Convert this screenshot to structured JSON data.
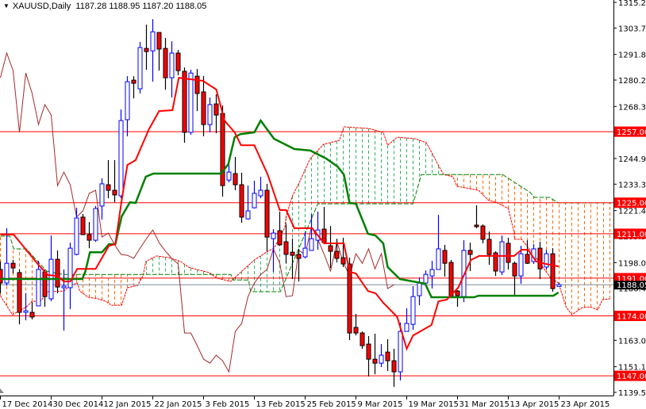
{
  "title": {
    "symbol": "XAUUSD,Daily",
    "ohlc": "1187.28 1188.95 1187.20 1188.05"
  },
  "chart_data": {
    "type": "candlestick",
    "symbol": "XAUUSD",
    "timeframe": "Daily",
    "ylim": [
      1139.55,
      1315.25
    ],
    "grid": false,
    "y_ticks": [
      "1315.25",
      "1303.70",
      "1291.80",
      "1280.25",
      "1268.35",
      "1244.90",
      "1233.35",
      "1221.45",
      "1209.90",
      "1198.00",
      "1186.45",
      "1163.00",
      "1151.10",
      "1139.55"
    ],
    "x_ticks": [
      {
        "bar": 0,
        "label": "17 Dec 2014"
      },
      {
        "bar": 8,
        "label": "30 Dec 2014"
      },
      {
        "bar": 16,
        "label": "12 Jan 2015"
      },
      {
        "bar": 24,
        "label": "22 Jan 2015"
      },
      {
        "bar": 32,
        "label": "3 Feb 2015"
      },
      {
        "bar": 40,
        "label": "13 Feb 2015"
      },
      {
        "bar": 48,
        "label": "25 Feb 2015"
      },
      {
        "bar": 56,
        "label": "9 Mar 2015"
      },
      {
        "bar": 64,
        "label": "19 Mar 2015"
      },
      {
        "bar": 72,
        "label": "31 Mar 2015"
      },
      {
        "bar": 80,
        "label": "13 Apr 2015"
      },
      {
        "bar": 88,
        "label": "23 Apr 2015"
      }
    ],
    "levels": [
      {
        "price": 1257.0,
        "label": "1257.00"
      },
      {
        "price": 1225.0,
        "label": "1225.00"
      },
      {
        "price": 1211.0,
        "label": "1211.00"
      },
      {
        "price": 1191.0,
        "label": "1191.00"
      },
      {
        "price": 1174.0,
        "label": "1174.00"
      },
      {
        "price": 1147.0,
        "label": "1147.00"
      }
    ],
    "current_price": {
      "price": 1188.05,
      "label": "1188.05"
    },
    "candles_format": "open,high,low,close",
    "candles": [
      [
        1194.9,
        1198.5,
        1184.2,
        1188.8
      ],
      [
        1188.8,
        1213.5,
        1187.7,
        1197.7
      ],
      [
        1197.7,
        1199.2,
        1193.1,
        1195.6
      ],
      [
        1193.5,
        1194.9,
        1170.2,
        1175.6
      ],
      [
        1175.6,
        1184.2,
        1172.0,
        1176.3
      ],
      [
        1175.6,
        1180.2,
        1172.4,
        1173.5
      ],
      [
        1178.5,
        1198.8,
        1178.5,
        1194.9
      ],
      [
        1193.8,
        1194.9,
        1178.1,
        1182.7
      ],
      [
        1181.7,
        1210.2,
        1180.6,
        1199.5
      ],
      [
        1199.5,
        1203.5,
        1184.2,
        1187.0
      ],
      [
        1186.7,
        1194.9,
        1167.4,
        1187.4
      ],
      [
        1186.7,
        1207.0,
        1177.0,
        1204.5
      ],
      [
        1201.7,
        1222.7,
        1201.3,
        1218.1
      ],
      [
        1218.5,
        1219.9,
        1210.6,
        1210.6
      ],
      [
        1210.6,
        1216.3,
        1204.5,
        1208.1
      ],
      [
        1208.1,
        1223.5,
        1207.4,
        1222.4
      ],
      [
        1223.5,
        1236.0,
        1217.4,
        1233.5
      ],
      [
        1233.1,
        1244.2,
        1227.0,
        1230.6
      ],
      [
        1230.6,
        1244.2,
        1225.2,
        1228.5
      ],
      [
        1228.1,
        1267.0,
        1227.0,
        1262.0
      ],
      [
        1262.4,
        1282.0,
        1254.9,
        1279.5
      ],
      [
        1280.2,
        1282.0,
        1272.0,
        1278.8
      ],
      [
        1276.3,
        1297.4,
        1274.2,
        1294.9
      ],
      [
        1294.5,
        1305.2,
        1284.9,
        1293.1
      ],
      [
        1293.4,
        1307.7,
        1279.5,
        1302.0
      ],
      [
        1301.7,
        1301.7,
        1284.5,
        1294.2
      ],
      [
        1294.5,
        1299.2,
        1275.9,
        1281.3
      ],
      [
        1281.3,
        1297.7,
        1272.4,
        1292.4
      ],
      [
        1292.4,
        1293.8,
        1282.4,
        1284.5
      ],
      [
        1284.2,
        1285.9,
        1252.0,
        1256.7
      ],
      [
        1256.7,
        1284.9,
        1255.6,
        1283.4
      ],
      [
        1282.0,
        1285.2,
        1266.3,
        1274.2
      ],
      [
        1274.9,
        1282.0,
        1254.9,
        1260.2
      ],
      [
        1260.2,
        1272.4,
        1256.7,
        1269.2
      ],
      [
        1269.5,
        1273.8,
        1256.3,
        1264.5
      ],
      [
        1265.2,
        1268.8,
        1227.7,
        1232.7
      ],
      [
        1235.2,
        1242.0,
        1234.2,
        1238.8
      ],
      [
        1238.1,
        1245.6,
        1230.6,
        1233.1
      ],
      [
        1233.1,
        1238.5,
        1216.0,
        1218.5
      ],
      [
        1217.7,
        1232.7,
        1217.4,
        1221.3
      ],
      [
        1222.7,
        1234.9,
        1222.4,
        1229.2
      ],
      [
        1228.1,
        1236.7,
        1227.0,
        1230.6
      ],
      [
        1230.6,
        1233.5,
        1203.1,
        1209.5
      ],
      [
        1208.8,
        1213.1,
        1193.8,
        1211.3
      ],
      [
        1212.4,
        1221.0,
        1205.6,
        1206.0
      ],
      [
        1207.4,
        1215.2,
        1197.7,
        1201.7
      ],
      [
        1202.7,
        1208.8,
        1190.6,
        1201.3
      ],
      [
        1201.7,
        1204.2,
        1189.5,
        1199.9
      ],
      [
        1200.6,
        1211.7,
        1199.9,
        1204.5
      ],
      [
        1203.5,
        1219.9,
        1203.5,
        1208.8
      ],
      [
        1208.1,
        1221.0,
        1203.8,
        1212.7
      ],
      [
        1213.1,
        1223.1,
        1206.3,
        1207.0
      ],
      [
        1205.6,
        1214.5,
        1195.6,
        1203.1
      ],
      [
        1203.1,
        1208.8,
        1198.1,
        1199.9
      ],
      [
        1200.2,
        1209.2,
        1196.0,
        1197.4
      ],
      [
        1197.4,
        1200.2,
        1163.1,
        1166.3
      ],
      [
        1168.8,
        1174.9,
        1165.2,
        1166.3
      ],
      [
        1166.3,
        1167.0,
        1159.2,
        1160.6
      ],
      [
        1161.3,
        1164.9,
        1146.7,
        1154.5
      ],
      [
        1154.5,
        1166.0,
        1147.7,
        1152.7
      ],
      [
        1152.7,
        1161.3,
        1151.0,
        1156.3
      ],
      [
        1157.7,
        1163.5,
        1149.2,
        1153.8
      ],
      [
        1153.8,
        1159.2,
        1142.0,
        1148.8
      ],
      [
        1148.8,
        1171.0,
        1144.9,
        1167.0
      ],
      [
        1167.0,
        1177.4,
        1167.0,
        1170.6
      ],
      [
        1170.2,
        1187.4,
        1167.7,
        1182.7
      ],
      [
        1183.1,
        1191.3,
        1178.8,
        1188.8
      ],
      [
        1188.8,
        1194.5,
        1187.4,
        1192.7
      ],
      [
        1192.0,
        1198.8,
        1186.3,
        1194.9
      ],
      [
        1194.9,
        1219.5,
        1194.9,
        1204.2
      ],
      [
        1203.5,
        1206.0,
        1191.7,
        1197.7
      ],
      [
        1198.1,
        1199.2,
        1182.4,
        1182.7
      ],
      [
        1185.2,
        1185.6,
        1178.1,
        1183.1
      ],
      [
        1182.7,
        1208.1,
        1180.2,
        1203.5
      ],
      [
        1203.5,
        1207.0,
        1194.2,
        1201.7
      ],
      [
        1214.9,
        1223.8,
        1213.5,
        1214.2
      ],
      [
        1214.5,
        1215.2,
        1206.7,
        1208.5
      ],
      [
        1208.5,
        1212.0,
        1197.0,
        1201.7
      ],
      [
        1202.4,
        1203.1,
        1192.0,
        1194.2
      ],
      [
        1193.8,
        1210.2,
        1192.4,
        1207.4
      ],
      [
        1206.7,
        1209.2,
        1194.9,
        1198.1
      ],
      [
        1197.7,
        1198.5,
        1183.5,
        1192.0
      ],
      [
        1192.0,
        1205.6,
        1188.5,
        1202.0
      ],
      [
        1201.7,
        1208.1,
        1197.4,
        1197.7
      ],
      [
        1198.5,
        1206.3,
        1197.4,
        1204.2
      ],
      [
        1204.5,
        1207.4,
        1190.6,
        1195.2
      ],
      [
        1196.0,
        1203.8,
        1194.9,
        1202.0
      ],
      [
        1202.0,
        1204.5,
        1184.9,
        1186.3
      ],
      [
        1187.28,
        1188.95,
        1187.2,
        1188.05
      ]
    ],
    "tenkan_sen": [
      [
        0,
        1210.6
      ],
      [
        2.1,
        1210.6
      ],
      [
        6,
        1197.0
      ],
      [
        7.5,
        1192.4
      ],
      [
        9,
        1192.0
      ],
      [
        10,
        1189.5
      ],
      [
        11,
        1189.5
      ],
      [
        12.1,
        1195.2
      ],
      [
        15,
        1195.2
      ],
      [
        17.1,
        1205.6
      ],
      [
        18.1,
        1206.3
      ],
      [
        19.1,
        1226.0
      ],
      [
        20,
        1242.0
      ],
      [
        21.3,
        1244.2
      ],
      [
        23.4,
        1258.1
      ],
      [
        25,
        1266.3
      ],
      [
        27.1,
        1266.7
      ],
      [
        28.1,
        1281.3
      ],
      [
        31.9,
        1279.9
      ],
      [
        34,
        1276.0
      ],
      [
        35.3,
        1262.0
      ],
      [
        36.9,
        1256.7
      ],
      [
        37.9,
        1250.9
      ],
      [
        40,
        1250.9
      ],
      [
        42.1,
        1237.7
      ],
      [
        44,
        1221.7
      ],
      [
        45,
        1221.7
      ],
      [
        46.3,
        1213.5
      ],
      [
        49.1,
        1213.5
      ],
      [
        51,
        1206.7
      ],
      [
        54.1,
        1206.7
      ],
      [
        55,
        1193.8
      ],
      [
        56,
        1193.1
      ],
      [
        57.9,
        1185.2
      ],
      [
        59.1,
        1184.2
      ],
      [
        60.3,
        1179.9
      ],
      [
        62.5,
        1173.5
      ],
      [
        64,
        1159.2
      ],
      [
        65,
        1165.2
      ],
      [
        67.9,
        1169.9
      ],
      [
        69,
        1180.6
      ],
      [
        70.3,
        1181.3
      ],
      [
        72.1,
        1186.7
      ],
      [
        74.1,
        1199.2
      ],
      [
        75.4,
        1201.0
      ],
      [
        80.9,
        1201.0
      ],
      [
        82.1,
        1203.8
      ],
      [
        83.1,
        1203.8
      ],
      [
        84.4,
        1198.5
      ],
      [
        85.9,
        1197.4
      ],
      [
        87.9,
        1196.3
      ]
    ],
    "kijun_sen": [
      [
        0,
        1190.6
      ],
      [
        12.9,
        1190.6
      ],
      [
        13.4,
        1194.2
      ],
      [
        14.1,
        1202.7
      ],
      [
        16,
        1202.7
      ],
      [
        17.1,
        1206.3
      ],
      [
        18.1,
        1206.3
      ],
      [
        19.1,
        1218.8
      ],
      [
        20.4,
        1225.2
      ],
      [
        21.3,
        1224.9
      ],
      [
        22.9,
        1236.7
      ],
      [
        24.1,
        1238.1
      ],
      [
        34.8,
        1238.1
      ],
      [
        35.9,
        1242.4
      ],
      [
        36.9,
        1254.5
      ],
      [
        37.8,
        1255.9
      ],
      [
        40,
        1256.7
      ],
      [
        41,
        1262.0
      ],
      [
        43.1,
        1253.8
      ],
      [
        46.3,
        1249.2
      ],
      [
        48.8,
        1248.5
      ],
      [
        51.3,
        1244.9
      ],
      [
        53.1,
        1241.3
      ],
      [
        54.1,
        1237.7
      ],
      [
        55,
        1224.9
      ],
      [
        56,
        1224.5
      ],
      [
        57.9,
        1211.0
      ],
      [
        59.1,
        1210.2
      ],
      [
        60.3,
        1206.7
      ],
      [
        61,
        1196.0
      ],
      [
        62.9,
        1190.6
      ],
      [
        66.9,
        1188.5
      ],
      [
        67.9,
        1182.4
      ],
      [
        74.6,
        1182.4
      ],
      [
        75.3,
        1183.1
      ],
      [
        87.1,
        1183.1
      ],
      [
        87.9,
        1184.5
      ]
    ],
    "senkou_span_a": [
      [
        0,
        1183.1
      ],
      [
        1.9,
        1174.5
      ],
      [
        4.1,
        1178.1
      ],
      [
        5,
        1180.6
      ],
      [
        6.3,
        1180.6
      ],
      [
        7.5,
        1184.9
      ],
      [
        10,
        1185.2
      ],
      [
        10.9,
        1187.7
      ],
      [
        12.1,
        1188.8
      ],
      [
        12.5,
        1185.2
      ],
      [
        13.8,
        1182.4
      ],
      [
        15.4,
        1181.7
      ],
      [
        16.6,
        1180.6
      ],
      [
        17.5,
        1178.8
      ],
      [
        19.1,
        1178.8
      ],
      [
        20,
        1186.7
      ],
      [
        21.6,
        1187.7
      ],
      [
        22.5,
        1192.4
      ],
      [
        22.9,
        1198.5
      ],
      [
        24.6,
        1201.0
      ],
      [
        26.6,
        1200.2
      ],
      [
        28.4,
        1198.5
      ],
      [
        29.6,
        1196.0
      ],
      [
        30.9,
        1194.9
      ],
      [
        32.9,
        1193.5
      ],
      [
        34.1,
        1191.0
      ],
      [
        36.3,
        1189.5
      ],
      [
        37.9,
        1193.8
      ],
      [
        40,
        1199.2
      ],
      [
        42.1,
        1203.1
      ],
      [
        43.1,
        1204.5
      ],
      [
        44.8,
        1213.8
      ],
      [
        45,
        1218.8
      ],
      [
        46,
        1228.1
      ],
      [
        47.1,
        1234.2
      ],
      [
        48.8,
        1244.9
      ],
      [
        50.9,
        1251.3
      ],
      [
        53.4,
        1253.1
      ],
      [
        54.1,
        1259.2
      ],
      [
        58.1,
        1258.4
      ],
      [
        60.3,
        1256.7
      ],
      [
        61,
        1250.9
      ],
      [
        62.5,
        1254.5
      ],
      [
        65.4,
        1253.8
      ],
      [
        67.1,
        1252.0
      ],
      [
        69.1,
        1241.3
      ],
      [
        69.8,
        1237.7
      ],
      [
        71.3,
        1236.7
      ],
      [
        71.9,
        1232.4
      ],
      [
        75.3,
        1230.6
      ],
      [
        76.9,
        1226.0
      ],
      [
        78.1,
        1225.2
      ],
      [
        80,
        1222.4
      ],
      [
        80.9,
        1211.7
      ],
      [
        81,
        1208.5
      ],
      [
        82.1,
        1208.5
      ],
      [
        84.4,
        1200.2
      ],
      [
        86.6,
        1191.3
      ],
      [
        87.9,
        1188.8
      ],
      [
        89.1,
        1178.1
      ],
      [
        90,
        1174.5
      ],
      [
        91.6,
        1177.7
      ],
      [
        92.9,
        1178.1
      ],
      [
        94.1,
        1176.7
      ],
      [
        94.8,
        1181.3
      ],
      [
        96,
        1181.7
      ]
    ],
    "senkou_span_b": [
      [
        0,
        1209.9
      ],
      [
        1.5,
        1209.9
      ],
      [
        2.1,
        1204.2
      ],
      [
        4.1,
        1204.2
      ],
      [
        5,
        1201.3
      ],
      [
        7.3,
        1194.2
      ],
      [
        9.8,
        1192.7
      ],
      [
        36.3,
        1192.7
      ],
      [
        36.6,
        1190.2
      ],
      [
        39.1,
        1190.2
      ],
      [
        39.4,
        1184.9
      ],
      [
        44.1,
        1184.9
      ],
      [
        50,
        1224.5
      ],
      [
        65,
        1224.5
      ],
      [
        66.3,
        1237.7
      ],
      [
        79.1,
        1237.7
      ],
      [
        83.5,
        1229.5
      ],
      [
        84.1,
        1227.4
      ],
      [
        86.5,
        1227.4
      ],
      [
        87.9,
        1224.9
      ],
      [
        96.3,
        1224.9
      ]
    ],
    "chikou_shift": 26,
    "colors": {
      "bull": "#0000ff",
      "bear_fill": "#ff0000",
      "bear_outline": "#000000",
      "tenkan": "#ff0000",
      "kijun": "#008000",
      "chikou": "#a52a2a",
      "senkou_a": "#ff0000",
      "senkou_b": "#008000",
      "cloud_bear": "#ff6a00",
      "cloud_bull": "#2fb35f",
      "level": "#ff0000",
      "current": "#7f8a96"
    }
  }
}
